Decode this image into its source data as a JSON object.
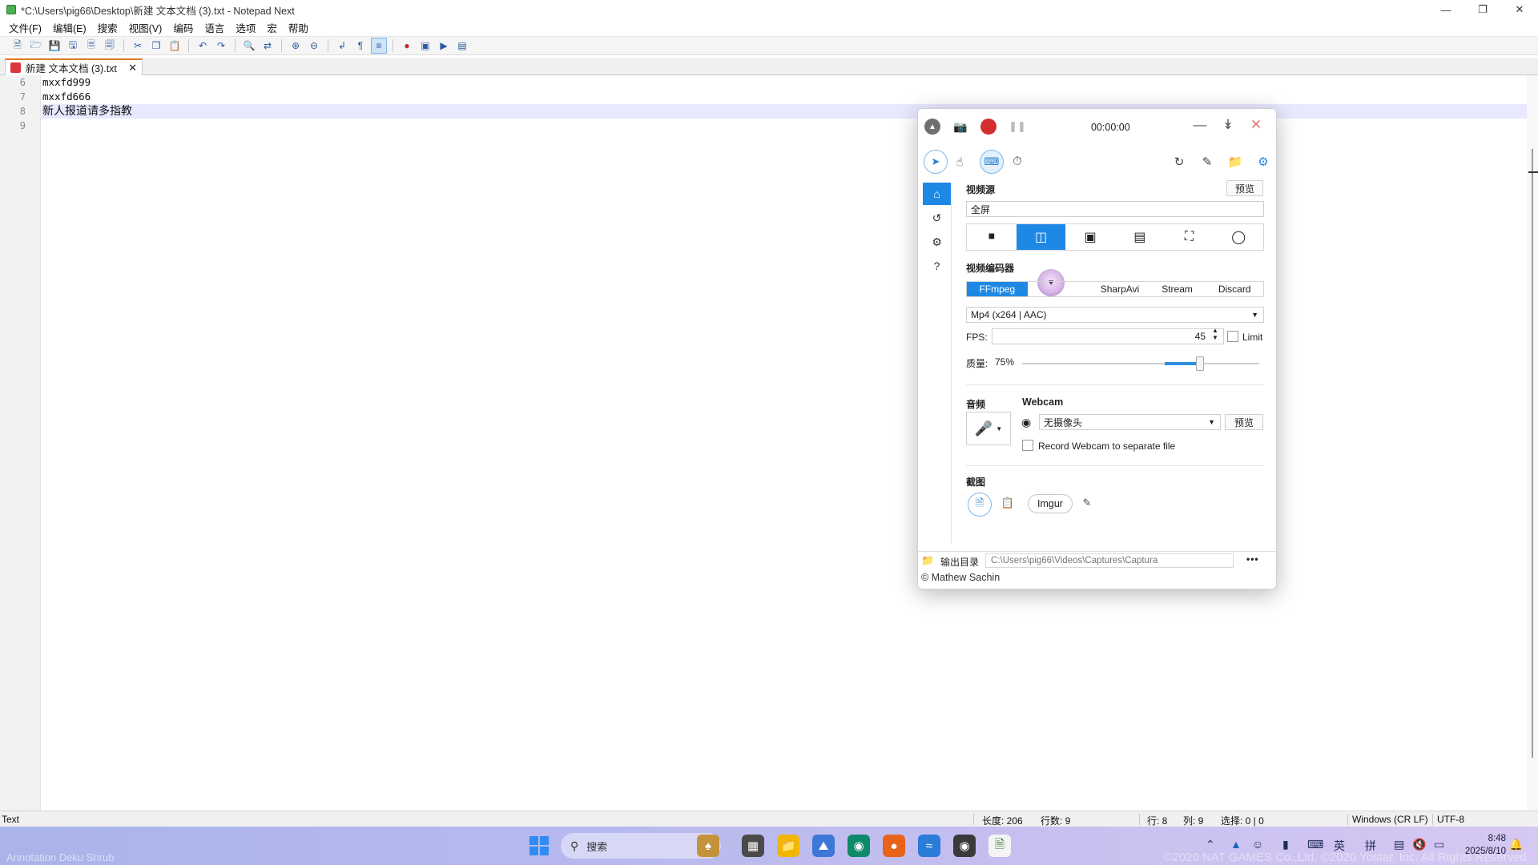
{
  "window": {
    "title": "*C:\\Users\\pig66\\Desktop\\新建 文本文档 (3).txt - Notepad Next",
    "minimize_icon": "minimize-icon",
    "maximize_icon": "restore-icon",
    "close_icon": "close-icon"
  },
  "menu": [
    "文件(F)",
    "编辑(E)",
    "搜索",
    "视图(V)",
    "编码",
    "语言",
    "选项",
    "宏",
    "帮助"
  ],
  "tab": {
    "label": "新建 文本文档 (3).txt",
    "close": "✕"
  },
  "editor": {
    "line_numbers": [
      "6",
      "7",
      "8",
      "9"
    ],
    "lines": [
      "mxxfd999",
      "mxxfd666",
      "新人报道请多指教",
      ""
    ],
    "current_line_index": 2
  },
  "statusbar": {
    "language": "Text",
    "length": "长度: 206",
    "lines": "行数: 9",
    "row": "行: 8",
    "col": "列: 9",
    "selection": "选择: 0 | 0",
    "eol": "Windows (CR LF)",
    "encoding": "UTF-8"
  },
  "captura": {
    "timer": "00:00:00",
    "video_source_label": "视频源",
    "preview_button": "预览",
    "video_source_value": "全屏",
    "video_encoder_label": "视频编码器",
    "encoders": [
      "FFmpeg",
      "SharpAvi",
      "Stream",
      "Discard"
    ],
    "active_encoder": "FFmpeg",
    "format_value": "Mp4 (x264 | AAC)",
    "fps_label": "FPS:",
    "fps_value": "45",
    "limit_label": "Limit",
    "quality_label": "质量:",
    "quality_value": "75%",
    "quality_fraction": 0.75,
    "audio_label": "音频",
    "webcam_label": "Webcam",
    "webcam_value": "无摄像头",
    "webcam_preview_button": "预览",
    "webcam_separate_label": "Record Webcam to separate file",
    "screenshot_label": "截图",
    "imgur_button": "Imgur",
    "output_dir_label": "输出目录",
    "output_dir_value": "C:\\Users\\pig66\\Videos\\Captures\\Captura",
    "more_button": "•••",
    "copyright": "© Mathew Sachin",
    "accent_color": "#1e88e5",
    "record_color": "#d32f2f"
  },
  "taskbar": {
    "search_placeholder": "搜索",
    "ime_lang": "英",
    "ime_mode": "拼",
    "time": "8:48",
    "date": "2025/8/10",
    "watermark_left": "Annotation Deku Shrub",
    "watermark_right": "©2020 NAT GAMES Co.,Ltd. ©2020 Yostar, Inc. All Rights Reserved."
  }
}
